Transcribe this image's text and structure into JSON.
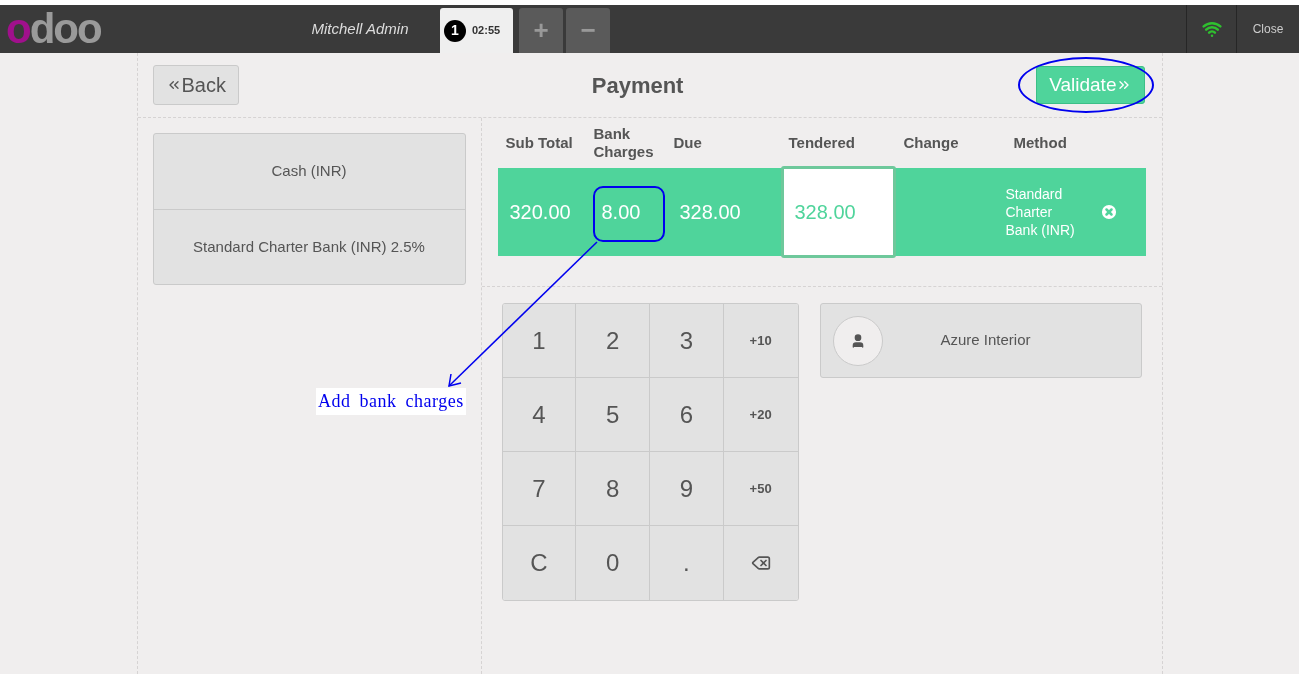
{
  "header": {
    "logo": "odoo",
    "user": "Mitchell Admin",
    "orders": [
      {
        "number": "1",
        "time": "02:55",
        "selected": true
      }
    ],
    "add_button": "+",
    "remove_button": "−",
    "close": "Close"
  },
  "screen": {
    "back": "Back",
    "title": "Payment",
    "validate": "Validate"
  },
  "methods": [
    "Cash (INR)",
    "Standard Charter Bank (INR) 2.5%"
  ],
  "paymentlines": {
    "columns": [
      "Sub Total",
      "Bank Charges",
      "Due",
      "Tendered",
      "Change",
      "Method"
    ],
    "rows": [
      {
        "sub_total": "320.00",
        "bank_charges": "8.00",
        "due": "328.00",
        "tendered": "328.00",
        "change": "",
        "method": "Standard Charter Bank (INR)",
        "selected": true
      }
    ]
  },
  "numpad": [
    {
      "kind": "key",
      "label": "1"
    },
    {
      "kind": "key",
      "label": "2"
    },
    {
      "kind": "key",
      "label": "3"
    },
    {
      "kind": "small",
      "label": "+10"
    },
    {
      "kind": "key",
      "label": "4"
    },
    {
      "kind": "key",
      "label": "5"
    },
    {
      "kind": "key",
      "label": "6"
    },
    {
      "kind": "small",
      "label": "+20"
    },
    {
      "kind": "key",
      "label": "7"
    },
    {
      "kind": "key",
      "label": "8"
    },
    {
      "kind": "key",
      "label": "9"
    },
    {
      "kind": "small",
      "label": "+50"
    },
    {
      "kind": "key",
      "label": "C"
    },
    {
      "kind": "key",
      "label": "0"
    },
    {
      "kind": "key",
      "label": "."
    },
    {
      "kind": "backspace"
    }
  ],
  "customer": "Azure Interior",
  "annotation": {
    "label": "Add bank charges"
  }
}
